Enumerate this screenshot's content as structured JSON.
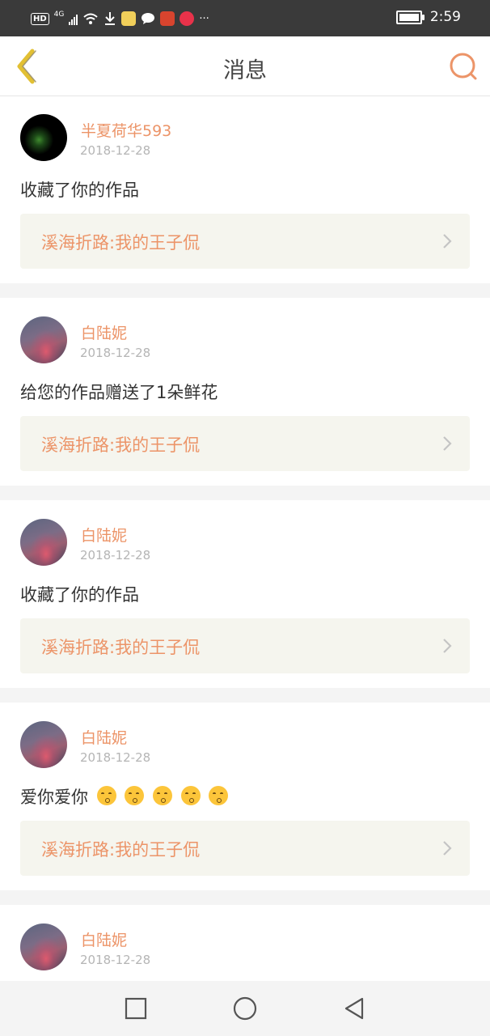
{
  "status_bar": {
    "network_label": "HD",
    "signal_type": "4G",
    "time": "2:59",
    "more": "···",
    "icons": [
      "hd-icon",
      "signal-icon",
      "wifi-icon",
      "download-icon",
      "app-icon",
      "chat-icon",
      "app-icon",
      "app-icon"
    ]
  },
  "header": {
    "title": "消息",
    "back_icon": "chevron-left-icon",
    "search_icon": "search-icon"
  },
  "colors": {
    "accent": "#ec9468",
    "back_icon": "#e2c033",
    "card_box": "#f5f5ee",
    "separator": "#f4f4f4"
  },
  "messages": [
    {
      "username": "半夏荷华593",
      "date": "2018-12-28",
      "text": "收藏了你的作品",
      "work": "溪海折路:我的王子侃"
    },
    {
      "username": "白陆妮",
      "date": "2018-12-28",
      "text": "给您的作品赠送了1朵鲜花",
      "work": "溪海折路:我的王子侃"
    },
    {
      "username": "白陆妮",
      "date": "2018-12-28",
      "text": "收藏了你的作品",
      "work": "溪海折路:我的王子侃"
    },
    {
      "username": "白陆妮",
      "date": "2018-12-28",
      "text": "爱你爱你",
      "emoji_count": 5,
      "work": "溪海折路:我的王子侃"
    },
    {
      "username": "白陆妮",
      "date": "2018-12-28"
    }
  ],
  "nav_bar": {
    "icons": [
      "square-icon",
      "circle-icon",
      "triangle-back-icon"
    ]
  }
}
